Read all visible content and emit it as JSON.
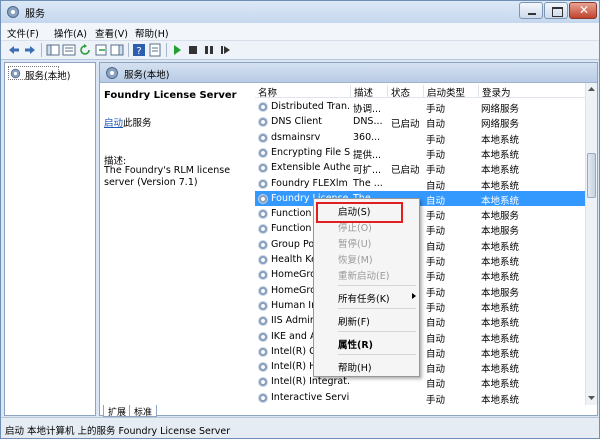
{
  "window": {
    "title": "服务",
    "controls": {
      "close_label": "✕"
    }
  },
  "menu": [
    "文件(F)",
    "操作(A)",
    "查看(V)",
    "帮助(H)"
  ],
  "tree": {
    "root": "服务(本地)"
  },
  "pane": {
    "header": "服务(本地)"
  },
  "description": {
    "service_name": "Foundry License Server",
    "start_link": "启动",
    "start_suffix": "此服务",
    "desc_label": "描述:",
    "desc_text": "The Foundry's RLM license server (Version 7.1)"
  },
  "list": {
    "columns": [
      "名称",
      "描述",
      "状态",
      "启动类型",
      "登录为"
    ],
    "rows": [
      {
        "name": "Distributed Tran...",
        "desc": "协调...",
        "status": "",
        "startup": "手动",
        "logon": "网络服务"
      },
      {
        "name": "DNS Client",
        "desc": "DNS...",
        "status": "已启动",
        "startup": "自动",
        "logon": "网络服务"
      },
      {
        "name": "dsmainsrv",
        "desc": "360...",
        "status": "",
        "startup": "手动",
        "logon": "本地系统"
      },
      {
        "name": "Encrypting File S...",
        "desc": "提供...",
        "status": "",
        "startup": "手动",
        "logon": "本地系统"
      },
      {
        "name": "Extensible Authe...",
        "desc": "可扩...",
        "status": "已启动",
        "startup": "手动",
        "logon": "本地系统"
      },
      {
        "name": "Foundry FLEXlm ...",
        "desc": "The ...",
        "status": "",
        "startup": "自动",
        "logon": "本地系统"
      },
      {
        "name": "Foundry License ...",
        "desc": "The ...",
        "status": "",
        "startup": "自动",
        "logon": "本地系统",
        "selected": true
      },
      {
        "name": "Function D...",
        "desc": "",
        "status": "",
        "startup": "手动",
        "logon": "本地服务"
      },
      {
        "name": "Function D...",
        "desc": "",
        "status": "",
        "startup": "手动",
        "logon": "本地服务"
      },
      {
        "name": "Group Po...",
        "desc": "",
        "status": "",
        "startup": "自动",
        "logon": "本地系统"
      },
      {
        "name": "Health Ke...",
        "desc": "",
        "status": "",
        "startup": "手动",
        "logon": "本地系统"
      },
      {
        "name": "HomeGro...",
        "desc": "",
        "status": "",
        "startup": "手动",
        "logon": "本地系统"
      },
      {
        "name": "HomeGro...",
        "desc": "",
        "status": "",
        "startup": "手动",
        "logon": "本地服务"
      },
      {
        "name": "Human In...",
        "desc": "",
        "status": "",
        "startup": "手动",
        "logon": "本地系统"
      },
      {
        "name": "IIS Admin...",
        "desc": "",
        "status": "",
        "startup": "自动",
        "logon": "本地系统"
      },
      {
        "name": "IKE and A...",
        "desc": "",
        "status": "",
        "startup": "自动",
        "logon": "本地系统"
      },
      {
        "name": "Intel(R) Co...",
        "desc": "",
        "status": "",
        "startup": "自动",
        "logon": "本地系统"
      },
      {
        "name": "Intel(R) HI...",
        "desc": "",
        "status": "",
        "startup": "自动",
        "logon": "本地系统"
      },
      {
        "name": "Intel(R) Integrat...",
        "desc": "",
        "status": "",
        "startup": "自动",
        "logon": "本地系统"
      },
      {
        "name": "Interactive Servi...",
        "desc": "",
        "status": "",
        "startup": "手动",
        "logon": "本地系统"
      }
    ]
  },
  "context_menu": {
    "start": "启动(S)",
    "stop": "停止(O)",
    "pause": "暂停(U)",
    "resume": "恢复(M)",
    "restart": "重新启动(E)",
    "all_tasks": "所有任务(K)",
    "refresh": "刷新(F)",
    "properties": "属性(R)",
    "help": "帮助(H)"
  },
  "tabs": [
    "扩展",
    "标准"
  ],
  "status": "启动 本地计算机 上的服务 Foundry License Server"
}
